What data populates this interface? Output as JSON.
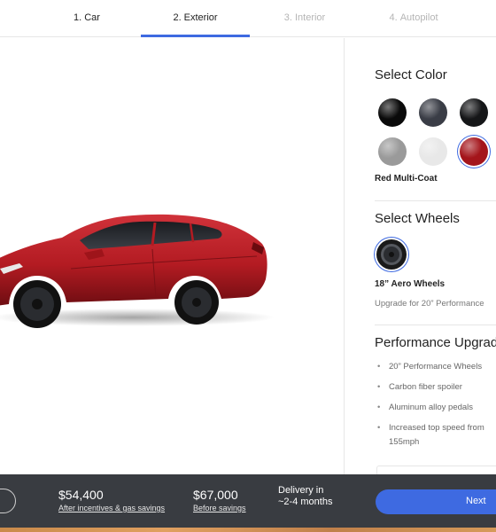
{
  "steps": [
    {
      "num": "1.",
      "label": "Car",
      "active": false
    },
    {
      "num": "2.",
      "label": "Exterior",
      "active": true
    },
    {
      "num": "3.",
      "label": "Interior",
      "active": false
    },
    {
      "num": "4.",
      "label": "Autopilot",
      "active": false
    }
  ],
  "colors": {
    "title": "Select Color",
    "swatches": [
      {
        "name": "black-swatch",
        "color": "#0a0a0a"
      },
      {
        "name": "midnight-silver-swatch",
        "color": "#3a3d46"
      },
      {
        "name": "deep-blue-swatch",
        "color": "#151618"
      },
      {
        "name": "silver-swatch",
        "color": "#9a9a9a"
      },
      {
        "name": "white-swatch",
        "color": "#e8e8e8"
      },
      {
        "name": "red-swatch",
        "color": "#a4151b"
      }
    ],
    "selected_name": "Red Multi-Coat"
  },
  "wheels": {
    "title": "Select Wheels",
    "selected_name": "18” Aero Wheels",
    "upgrade_text": "Upgrade for 20” Performance"
  },
  "performance": {
    "title": "Performance Upgrade",
    "items": [
      "20” Performance Wheels",
      "Carbon fiber spoiler",
      "Aluminum alloy pedals",
      "Increased top speed from 155mph"
    ]
  },
  "footer": {
    "price_after": "$54,400",
    "price_after_note": "After incentives & gas savings",
    "price_before": "$67,000",
    "price_before_note": "Before savings",
    "delivery": "Delivery in ~2-4 months",
    "next_label": "Next"
  },
  "accent_color": "#3e6ae1",
  "car_color": "#b31b22"
}
